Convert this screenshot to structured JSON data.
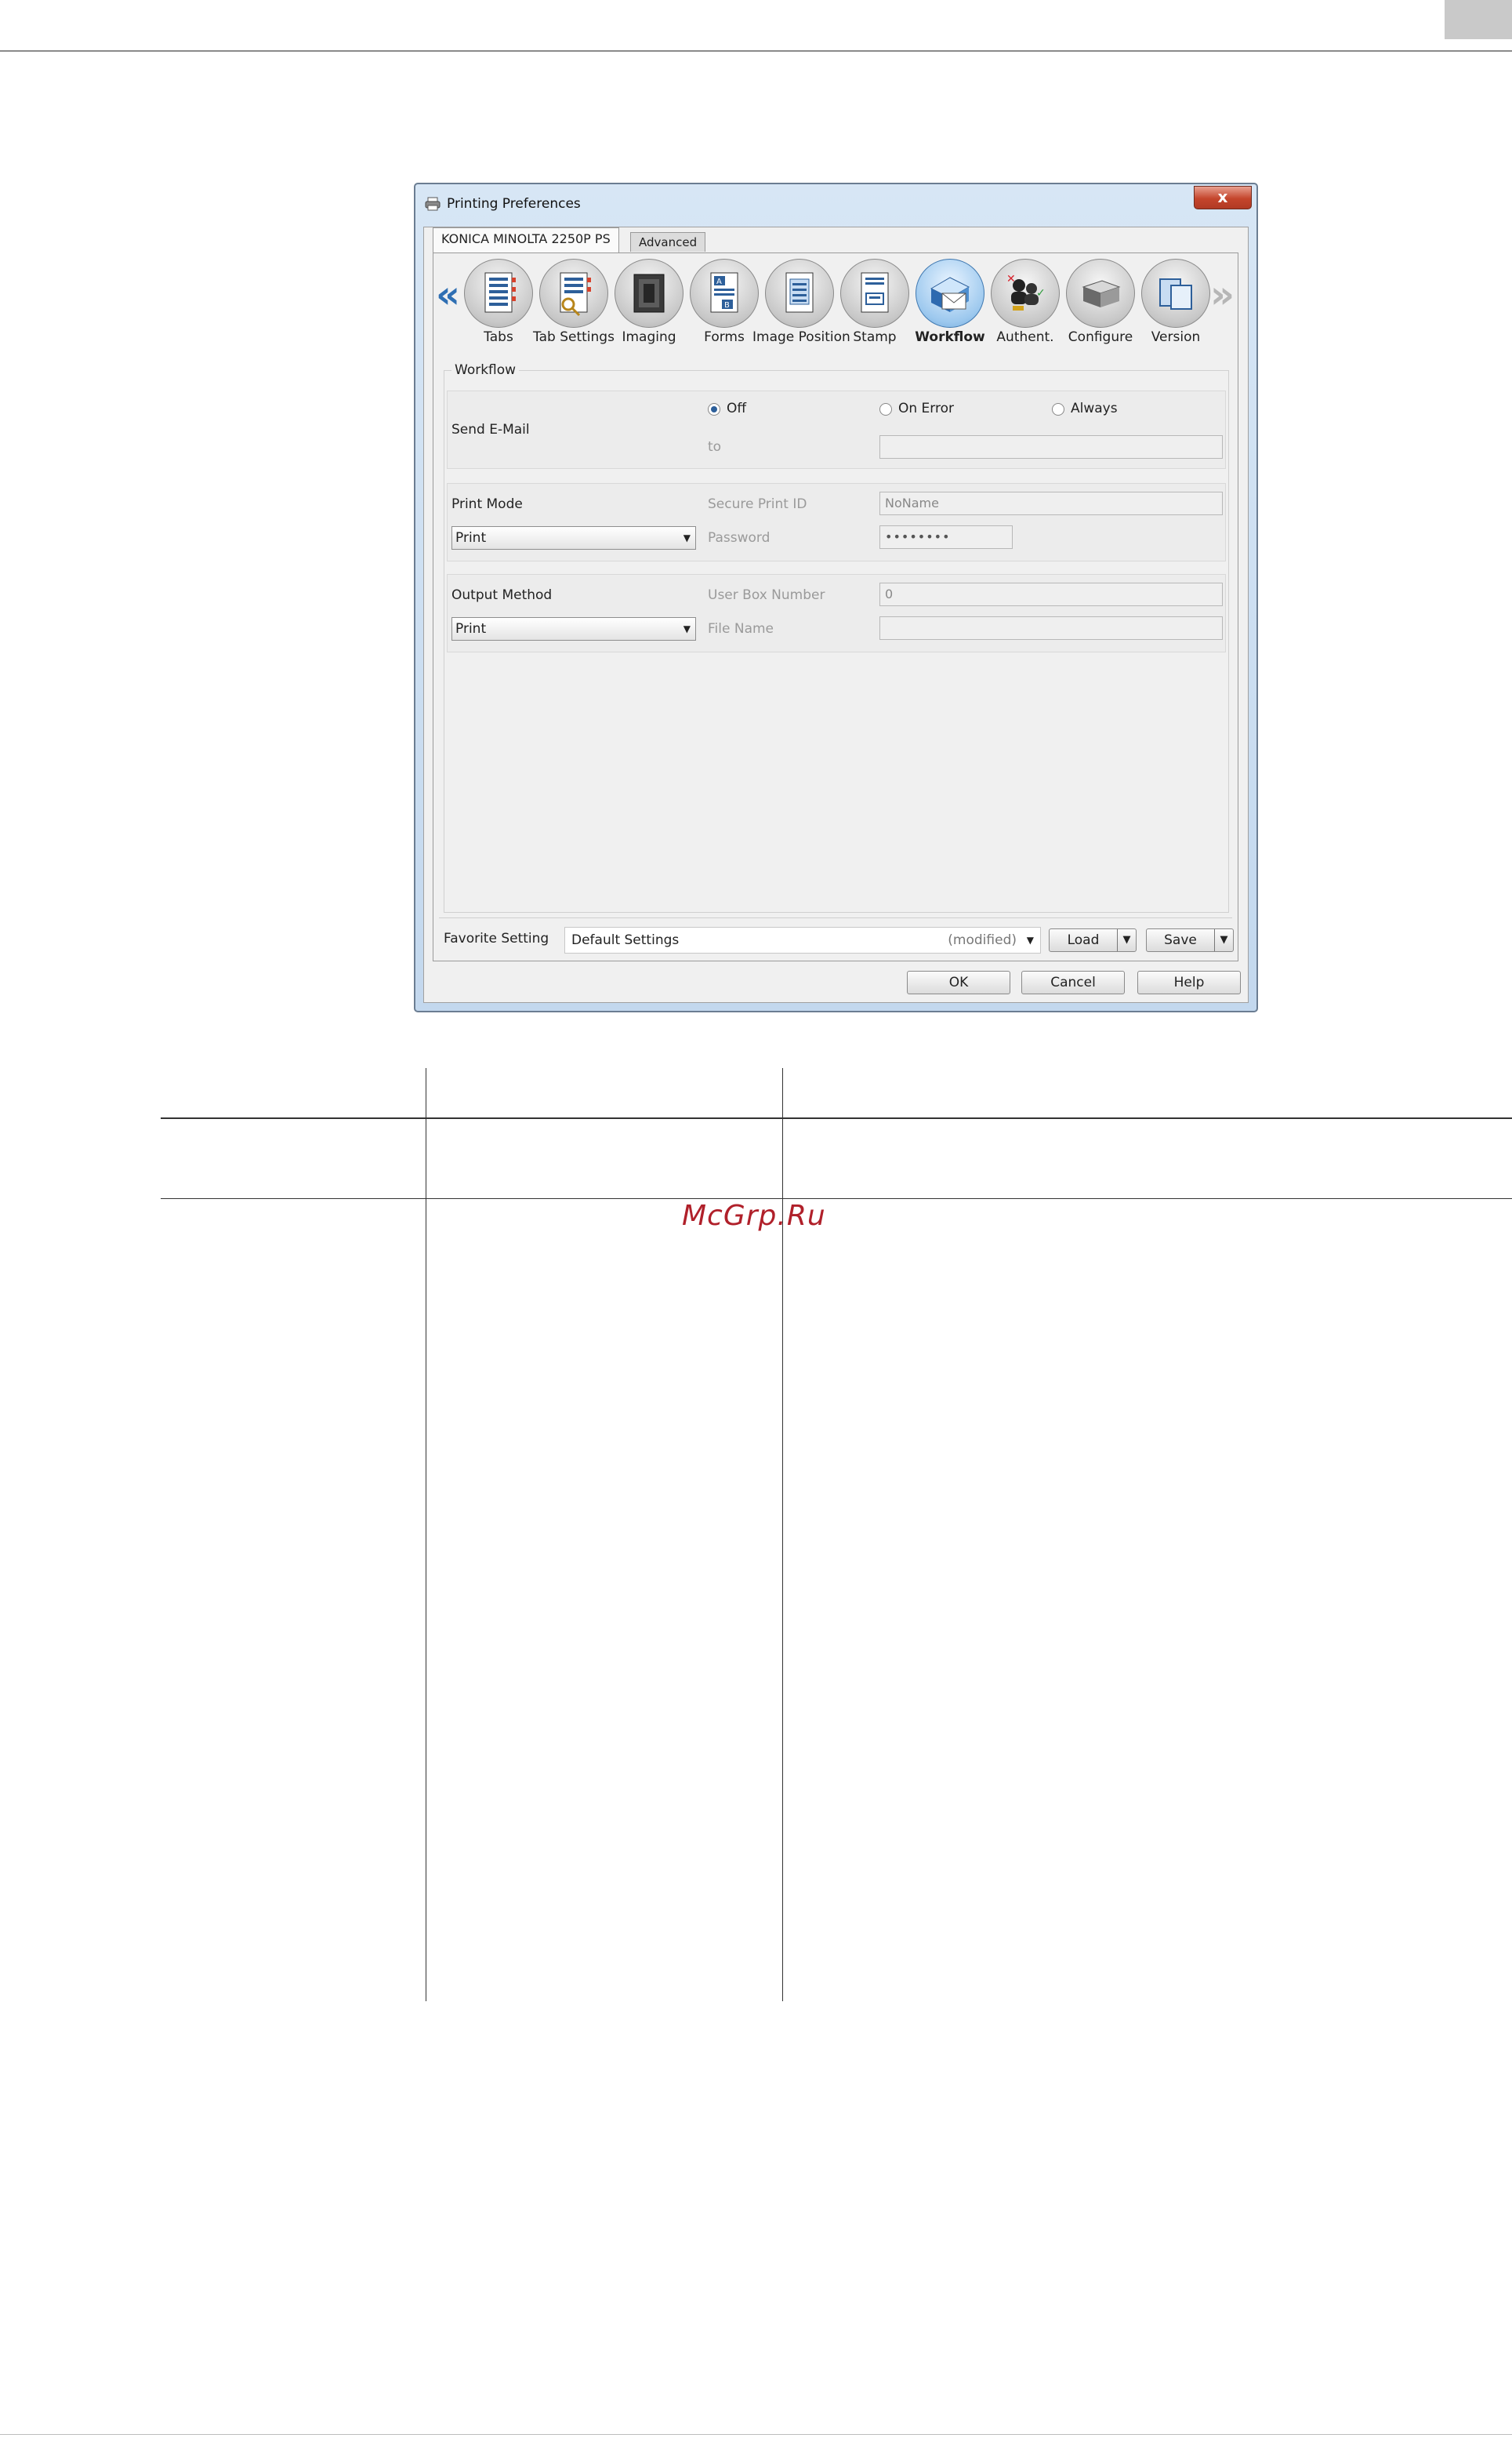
{
  "dialog": {
    "title": "Printing Preferences",
    "close_label": "x",
    "tabs": [
      {
        "label": "KONICA MINOLTA 2250P PS"
      },
      {
        "label": "Advanced"
      }
    ],
    "nav_prev": "«",
    "nav_next": "»",
    "icons": [
      {
        "label": "Tabs",
        "icon": "tabs-icon"
      },
      {
        "label": "Tab Settings",
        "icon": "tab-settings-icon"
      },
      {
        "label": "Imaging",
        "icon": "imaging-icon"
      },
      {
        "label": "Forms",
        "icon": "forms-icon"
      },
      {
        "label": "Image Position",
        "icon": "image-position-icon"
      },
      {
        "label": "Stamp",
        "icon": "stamp-icon"
      },
      {
        "label": "Workflow",
        "icon": "workflow-icon",
        "selected": true
      },
      {
        "label": "Authent.",
        "icon": "authentication-icon"
      },
      {
        "label": "Configure",
        "icon": "configure-icon"
      },
      {
        "label": "Version",
        "icon": "version-icon"
      }
    ],
    "workflow": {
      "section_title": "Workflow",
      "send_email": {
        "label": "Send E-Mail",
        "options": [
          "Off",
          "On Error",
          "Always"
        ],
        "selected": "Off",
        "to_label": "to",
        "to_value": ""
      },
      "print_mode": {
        "label": "Print Mode",
        "value": "Print",
        "secure_id_label": "Secure Print ID",
        "secure_id_value": "NoName",
        "password_label": "Password",
        "password_value": "••••••••"
      },
      "output_method": {
        "label": "Output Method",
        "value": "Print",
        "user_box_label": "User Box Number",
        "user_box_value": "0",
        "file_name_label": "File Name",
        "file_name_value": ""
      }
    },
    "favorite": {
      "label": "Favorite Setting",
      "value": "Default Settings",
      "modified": "(modified)",
      "load_label": "Load",
      "save_label": "Save"
    },
    "buttons": {
      "ok": "OK",
      "cancel": "Cancel",
      "help": "Help"
    }
  },
  "watermark": "McGrp.Ru",
  "colors": {
    "accent": "#2f6fb3",
    "watermark": "#b0202a"
  }
}
